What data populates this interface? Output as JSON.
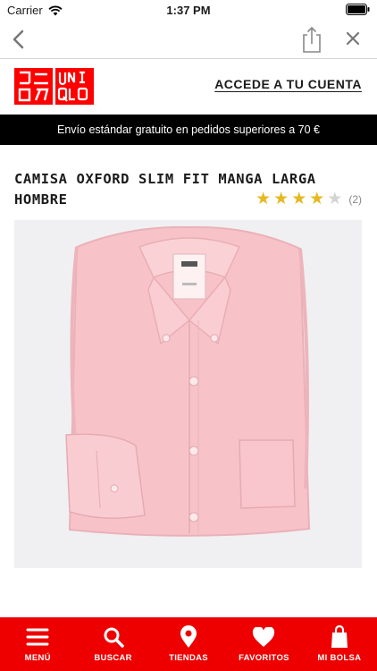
{
  "status_bar": {
    "carrier": "Carrier",
    "time": "1:37 PM"
  },
  "nav": {
    "back_icon": "chevron-left-icon",
    "share_icon": "share-icon",
    "close_icon": "close-icon"
  },
  "header": {
    "logo_left": "ユニクロ",
    "logo_right": "UNIQLO",
    "account_link": "ACCEDE A TU CUENTA"
  },
  "promo": {
    "text": "Envío estándar gratuito en pedidos superiores a 70 €"
  },
  "product": {
    "title_line1": "CAMISA OXFORD SLIM FIT MANGA LARGA",
    "title_line2": "HOMBRE",
    "rating": 4,
    "rating_max": 5,
    "review_count": "(2)",
    "image_icon": "pink-oxford-shirt-image"
  },
  "tab_bar": {
    "items": [
      {
        "label": "MENÚ",
        "icon": "menu-icon"
      },
      {
        "label": "BUSCAR",
        "icon": "search-icon"
      },
      {
        "label": "TIENDAS",
        "icon": "location-pin-icon"
      },
      {
        "label": "FAVORITOS",
        "icon": "heart-icon"
      },
      {
        "label": "MI BOLSA",
        "icon": "shopping-bag-icon"
      }
    ]
  },
  "colors": {
    "brand_red": "#ee0000",
    "logo_red": "#ff0000",
    "promo_bg": "#000000",
    "star_on": "#e7b820",
    "star_off": "#d4d4d4"
  }
}
